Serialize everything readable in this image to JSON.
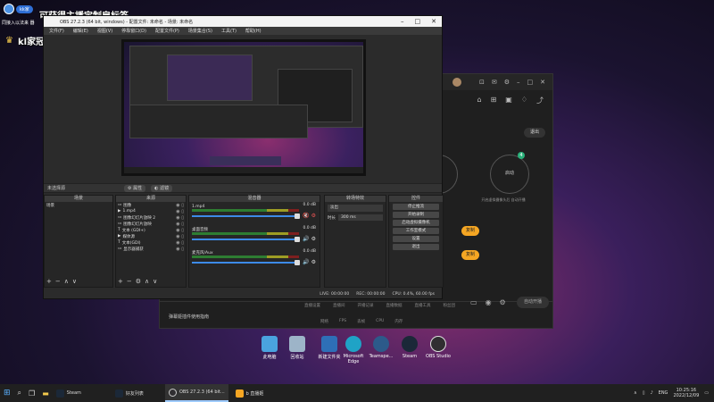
{
  "overlay": {
    "user_chip": "kk家",
    "banner": "可获得主播定制扇标签",
    "caption": "同接入以法来\n器",
    "nickname": "kl家冠名商: Hw"
  },
  "obs": {
    "title": "OBS 27.2.3 (64 bit, windows) - 配置文件: 未命名 - 场景: 未命名",
    "menu": [
      "文件(F)",
      "编辑(E)",
      "视图(V)",
      "停靠窗口(D)",
      "配置文件(P)",
      "场景集合(S)",
      "工具(T)",
      "帮助(H)"
    ],
    "scene_bar": {
      "selected": "未选择源",
      "properties": "属性",
      "filters": "滤镜"
    },
    "docks": {
      "scenes": {
        "title": "场景",
        "items": [
          "场景"
        ]
      },
      "sources": {
        "title": "来源",
        "items": [
          {
            "icon": "▭",
            "label": "图像"
          },
          {
            "icon": "▶",
            "label": "1.mp4"
          },
          {
            "icon": "▭",
            "label": "图像幻灯片放映 2"
          },
          {
            "icon": "▭",
            "label": "图像幻灯片放映"
          },
          {
            "icon": "T",
            "label": "文本 (GDI+)"
          },
          {
            "icon": "▶",
            "label": "媒体源"
          },
          {
            "icon": "T",
            "label": "文本(GDI)"
          },
          {
            "icon": "▭",
            "label": "显示器捕获"
          }
        ]
      },
      "mixer": {
        "title": "混音器",
        "rows": [
          {
            "name": "1.mp4",
            "db": "0.0 dB"
          },
          {
            "name": "桌面音频",
            "db": "0.0 dB"
          },
          {
            "name": "麦克风/Aux",
            "db": "0.0 dB"
          }
        ]
      },
      "transitions": {
        "title": "转场特效",
        "type": "淡出",
        "duration_label": "时长",
        "duration_value": "300 ms"
      },
      "controls": {
        "title": "控件",
        "buttons": [
          "停止推流",
          "开始录制",
          "启动虚拟摄像机",
          "工作室模式",
          "设置",
          "退出"
        ]
      }
    },
    "status": {
      "live": "LIVE: 00:00:00",
      "rec": "REC: 00:00:00",
      "cpu": "CPU: 0.4%, 60.00 fps"
    }
  },
  "broadcast": {
    "exit_label": "退出",
    "start_label": "启动",
    "start_badge": "4",
    "hint": "开启虚拟摄像头后\n自动开播",
    "yellow1": "复制",
    "yellow2": "复制",
    "golive": "自动开播",
    "notice": "弹幕姬插件使用指南",
    "tabs": [
      "直播设置",
      "直播间",
      "开播记录",
      "直播数据",
      "直播工具",
      "粉丝团"
    ],
    "stats": [
      "网络",
      "FPS",
      "丢帧",
      "CPU",
      "内存"
    ]
  },
  "desktop": {
    "icons": [
      {
        "label": "此电脑",
        "color": "#4aa3df"
      },
      {
        "label": "回收站",
        "color": "#9db4c8"
      },
      {
        "label": "新建文件夹",
        "color": "#2e6fb7"
      },
      {
        "label": "Microsoft Edge",
        "color": "#1fa3c6"
      },
      {
        "label": "Teamspe...",
        "color": "#2c5a8a"
      },
      {
        "label": "Steam",
        "color": "#1b2838"
      },
      {
        "label": "OBS Studio",
        "color": "#302e31"
      }
    ]
  },
  "taskbar": {
    "items": [
      {
        "label": "Steam",
        "color": "#1b2838"
      },
      {
        "label": "好友列表",
        "color": "#1b2838"
      },
      {
        "label": "OBS 27.2.3 (64 bit...",
        "color": "#302e31"
      },
      {
        "label": "b 直播姬",
        "color": "#f5a623"
      }
    ],
    "lang": "ENG",
    "time": "10:25:16",
    "date": "2022/12/09"
  }
}
